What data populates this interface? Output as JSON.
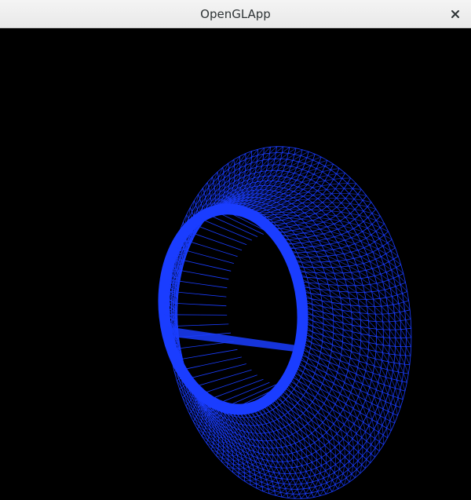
{
  "window": {
    "title": "OpenGLApp",
    "close_icon": "close-icon"
  },
  "viewport": {
    "background_color": "#000000",
    "render_mode": "wireframe",
    "mesh_color": "#1a3dff",
    "shape": "torus-like surface of revolution"
  }
}
